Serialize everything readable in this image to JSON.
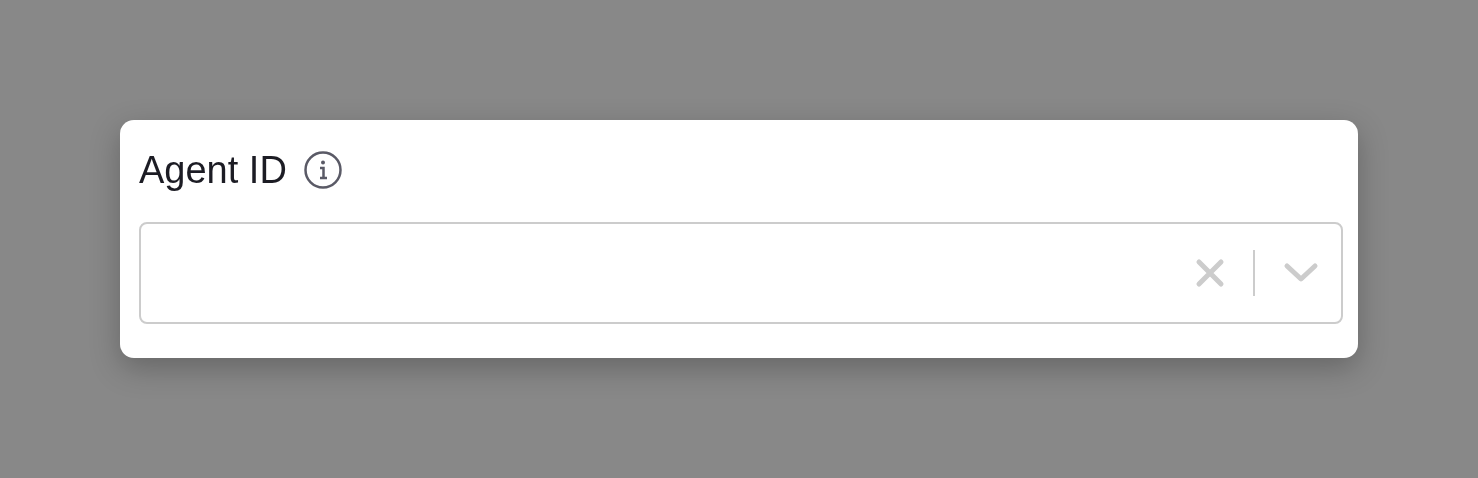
{
  "field": {
    "label": "Agent ID"
  }
}
